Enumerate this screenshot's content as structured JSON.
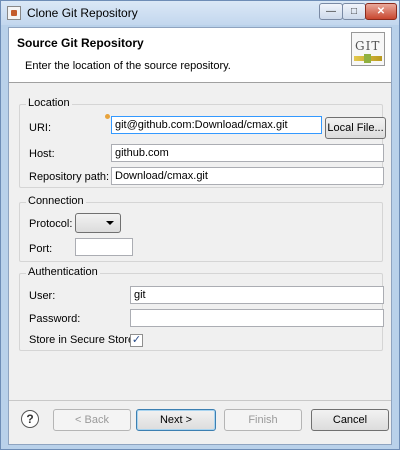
{
  "window": {
    "title": "Clone Git Repository",
    "min_glyph": "—",
    "max_glyph": "□",
    "close_glyph": "✕"
  },
  "header": {
    "title": "Source Git Repository",
    "description": "Enter the location of the source repository.",
    "logo_text": "GIT"
  },
  "location": {
    "group_title": "Location",
    "uri_label": "URI:",
    "uri_value": "git@github.com:Download/cmax.git",
    "local_file_button": "Local File...",
    "host_label": "Host:",
    "host_value": "github.com",
    "repo_path_label": "Repository path:",
    "repo_path_value": "Download/cmax.git"
  },
  "connection": {
    "group_title": "Connection",
    "protocol_label": "Protocol:",
    "protocol_value": "",
    "port_label": "Port:",
    "port_value": ""
  },
  "authentication": {
    "group_title": "Authentication",
    "user_label": "User:",
    "user_value": "git",
    "password_label": "Password:",
    "password_value": "",
    "secure_store_label": "Store in Secure Store",
    "secure_store_checked": true,
    "check_glyph": "✓"
  },
  "footer": {
    "help_glyph": "?",
    "back_button": "< Back",
    "next_button": "Next >",
    "finish_button": "Finish",
    "cancel_button": "Cancel"
  },
  "colors": {
    "window_frame": "#b9d1ea",
    "dialog_bg": "#f0f0f0",
    "focus_border": "#3399ff"
  }
}
